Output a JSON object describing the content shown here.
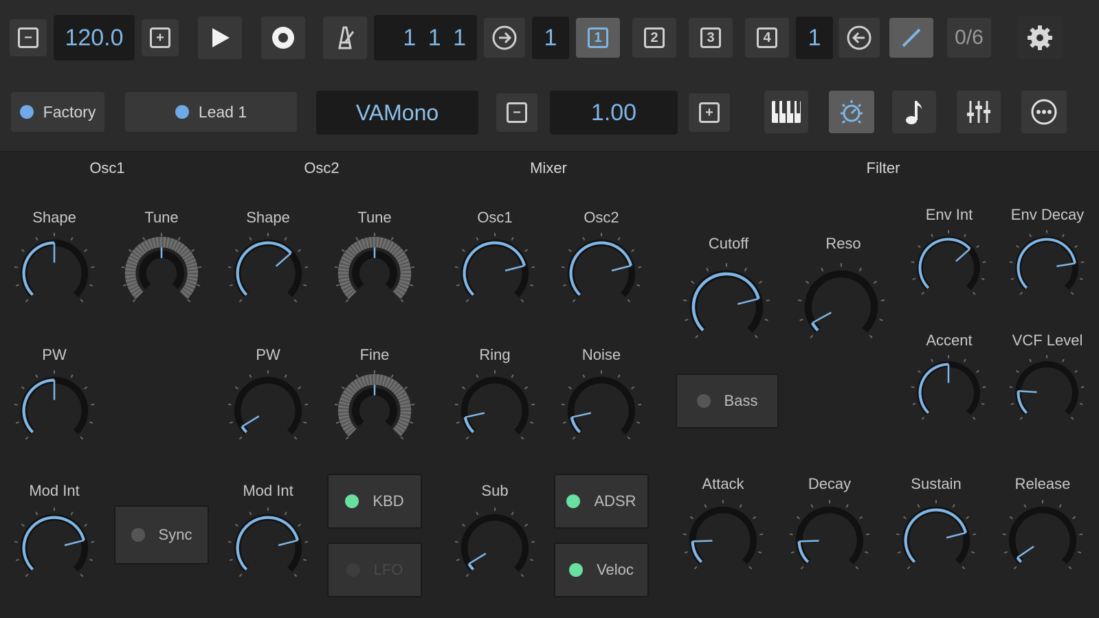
{
  "transport": {
    "tempo": "120.0",
    "position": "1 1 1",
    "step_value": "1",
    "patterns": [
      "1",
      "2",
      "3",
      "4"
    ],
    "pattern_count": "1",
    "steps": "0/6"
  },
  "preset": {
    "bank": "Factory",
    "patch": "Lead 1",
    "synth": "VAMono",
    "value": "1.00"
  },
  "sections": {
    "osc1": "Osc1",
    "osc2": "Osc2",
    "mixer": "Mixer",
    "filter": "Filter"
  },
  "knob_labels": {
    "osc1_shape": "Shape",
    "osc1_tune": "Tune",
    "osc2_shape": "Shape",
    "osc2_tune": "Tune",
    "mix_osc1": "Osc1",
    "mix_osc2": "Osc2",
    "cutoff": "Cutoff",
    "reso": "Reso",
    "env_int": "Env Int",
    "env_decay": "Env Decay",
    "osc1_pw": "PW",
    "osc2_pw": "PW",
    "fine": "Fine",
    "ring": "Ring",
    "noise": "Noise",
    "accent": "Accent",
    "vcf_level": "VCF Level",
    "osc1_mod": "Mod Int",
    "osc2_mod": "Mod Int",
    "sub": "Sub",
    "attack": "Attack",
    "decay": "Decay",
    "sustain": "Sustain",
    "release": "Release"
  },
  "toggles": {
    "sync": "Sync",
    "kbd": "KBD",
    "lfo": "LFO",
    "adsr": "ADSR",
    "veloc": "Veloc",
    "bass": "Bass"
  },
  "knob_values": {
    "osc1_shape": 0.5,
    "osc1_tune": 0.5,
    "osc2_shape": 0.68,
    "osc2_tune": 0.5,
    "mix_osc1": 0.78,
    "mix_osc2": 0.78,
    "cutoff": 0.78,
    "reso": 0.06,
    "env_int": 0.68,
    "env_decay": 0.8,
    "osc1_pw": 0.5,
    "osc2_pw": 0.05,
    "fine": 0.5,
    "ring": 0.12,
    "noise": 0.12,
    "accent": 0.5,
    "vcf_level": 0.18,
    "osc1_mod": 0.78,
    "osc2_mod": 0.78,
    "sub": 0.05,
    "attack": 0.16,
    "decay": 0.16,
    "sustain": 0.78,
    "release": 0.04
  },
  "colors": {
    "accent": "#7fb6e6",
    "led_on": "#69e0a0",
    "knob_track": "#111111"
  }
}
